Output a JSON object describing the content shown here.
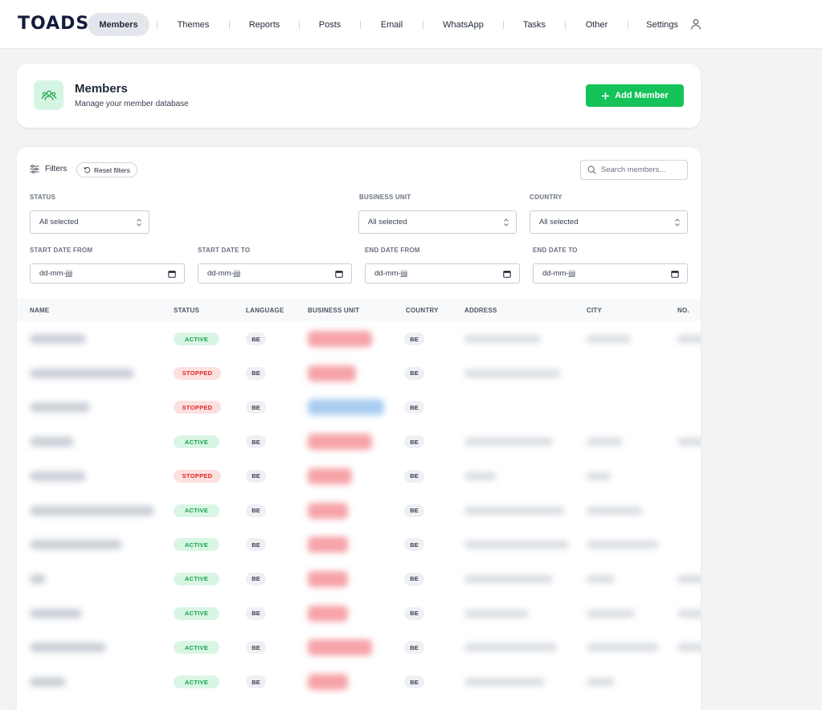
{
  "brand": {
    "logo": "TOADS"
  },
  "nav": {
    "items": [
      {
        "label": "Members",
        "active": true
      },
      {
        "label": "Themes"
      },
      {
        "label": "Reports"
      },
      {
        "label": "Posts"
      },
      {
        "label": "Email"
      },
      {
        "label": "WhatsApp"
      },
      {
        "label": "Tasks"
      },
      {
        "label": "Other"
      },
      {
        "label": "Settings"
      }
    ]
  },
  "header": {
    "title": "Members",
    "subtitle": "Manage your member database",
    "add_button": "Add Member"
  },
  "filters": {
    "label": "Filters",
    "reset": "Reset filters",
    "search_placeholder": "Search members...",
    "status": {
      "label": "STATUS",
      "value": "All selected"
    },
    "business_unit": {
      "label": "BUSINESS UNIT",
      "value": "All selected"
    },
    "country": {
      "label": "COUNTRY",
      "value": "All selected"
    },
    "start_from": {
      "label": "START DATE FROM",
      "value": "dd-mm-jjjj"
    },
    "start_to": {
      "label": "START DATE TO",
      "value": "dd-mm-jjjj"
    },
    "end_from": {
      "label": "END DATE FROM",
      "value": "dd-mm-jjjj"
    },
    "end_to": {
      "label": "END DATE TO",
      "value": "dd-mm-jjjj"
    }
  },
  "table": {
    "columns": [
      "NAME",
      "STATUS",
      "LANGUAGE",
      "BUSINESS UNIT",
      "COUNTRY",
      "ADDRESS",
      "CITY",
      "NO."
    ],
    "rows": [
      {
        "status": "ACTIVE",
        "status_kind": "active",
        "language": "BE",
        "country": "BE",
        "unit_color": "red"
      },
      {
        "status": "STOPPED",
        "status_kind": "stopped",
        "language": "BE",
        "country": "BE",
        "unit_color": "red"
      },
      {
        "status": "STOPPED",
        "status_kind": "stopped",
        "language": "BE",
        "country": "BE",
        "unit_color": "blue"
      },
      {
        "status": "ACTIVE",
        "status_kind": "active",
        "language": "BE",
        "country": "BE",
        "unit_color": "red"
      },
      {
        "status": "STOPPED",
        "status_kind": "stopped",
        "language": "BE",
        "country": "BE",
        "unit_color": "red"
      },
      {
        "status": "ACTIVE",
        "status_kind": "active",
        "language": "BE",
        "country": "BE",
        "unit_color": "red"
      },
      {
        "status": "ACTIVE",
        "status_kind": "active",
        "language": "BE",
        "country": "BE",
        "unit_color": "red"
      },
      {
        "status": "ACTIVE",
        "status_kind": "active",
        "language": "BE",
        "country": "BE",
        "unit_color": "red"
      },
      {
        "status": "ACTIVE",
        "status_kind": "active",
        "language": "BE",
        "country": "BE",
        "unit_color": "red"
      },
      {
        "status": "ACTIVE",
        "status_kind": "active",
        "language": "BE",
        "country": "BE",
        "unit_color": "red"
      },
      {
        "status": "ACTIVE",
        "status_kind": "active",
        "language": "BE",
        "country": "BE",
        "unit_color": "red"
      }
    ]
  },
  "colors": {
    "accent": "#15c35a",
    "active_bg": "#d9f6e4",
    "active_fg": "#15a34a",
    "stopped_bg": "#fde0e0",
    "stopped_fg": "#dc2626",
    "blurred_unit_red": "#f6a3a8",
    "blurred_unit_blue": "#a9cdf0"
  },
  "icons": {
    "user": "user-icon",
    "members": "members-icon",
    "plus": "plus-icon",
    "filters": "sliders-icon",
    "reset": "rotate-ccw-icon",
    "search": "search-icon",
    "select": "chevron-up-down-icon",
    "date": "calendar-icon"
  }
}
